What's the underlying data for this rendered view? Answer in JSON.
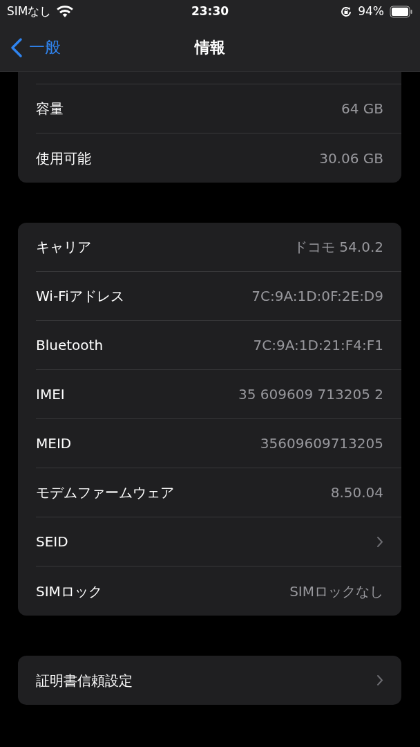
{
  "status_bar": {
    "carrier": "SIMなし",
    "time": "23:30",
    "battery": "94%"
  },
  "nav": {
    "back": "一般",
    "title": "情報"
  },
  "sections": [
    {
      "cut_top": true,
      "rows": [
        {
          "kind": "value",
          "label": "容量",
          "value": "64 GB"
        },
        {
          "kind": "value",
          "label": "使用可能",
          "value": "30.06 GB"
        }
      ]
    },
    {
      "cut_top": false,
      "rows": [
        {
          "kind": "value",
          "label": "キャリア",
          "value": "ドコモ 54.0.2"
        },
        {
          "kind": "value",
          "label": "Wi-Fiアドレス",
          "value": "7C:9A:1D:0F:2E:D9"
        },
        {
          "kind": "value",
          "label": "Bluetooth",
          "value": "7C:9A:1D:21:F4:F1"
        },
        {
          "kind": "value",
          "label": "IMEI",
          "value": "35 609609 713205 2"
        },
        {
          "kind": "value",
          "label": "MEID",
          "value": "35609609713205"
        },
        {
          "kind": "value",
          "label": "モデムファームウェア",
          "value": "8.50.04"
        },
        {
          "kind": "link",
          "label": "SEID"
        },
        {
          "kind": "value",
          "label": "SIMロック",
          "value": "SIMロックなし"
        }
      ]
    },
    {
      "cut_top": false,
      "rows": [
        {
          "kind": "link",
          "label": "証明書信頼設定"
        }
      ]
    }
  ]
}
